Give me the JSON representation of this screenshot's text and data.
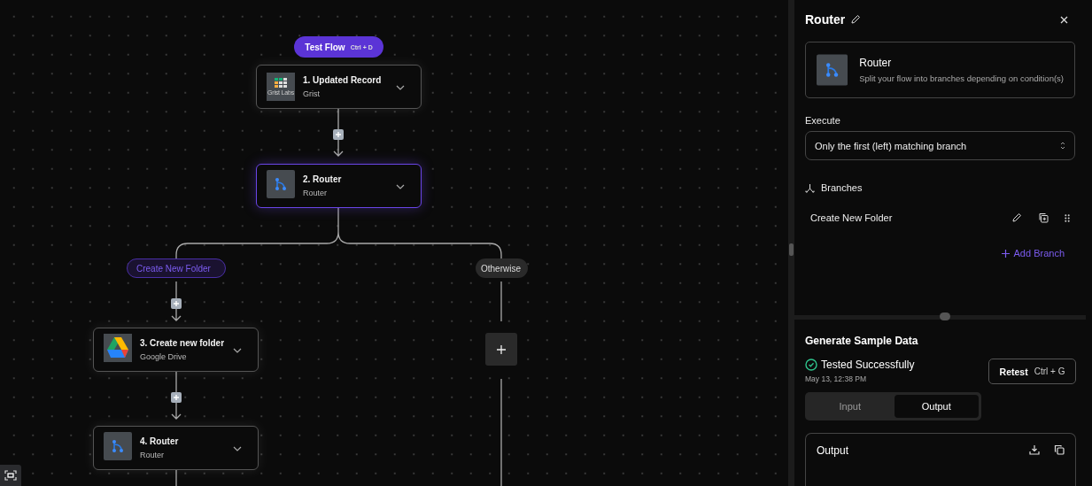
{
  "canvas": {
    "test_flow_button": {
      "label": "Test Flow",
      "shortcut": "Ctrl + D"
    },
    "steps": [
      {
        "title": "1. Updated Record",
        "app": "Grist",
        "kind": "grist",
        "logo_text": "Grist Labs",
        "selected": false
      },
      {
        "title": "2. Router",
        "app": "Router",
        "kind": "router",
        "selected": true
      },
      {
        "title": "3. Create new folder",
        "app": "Google Drive",
        "kind": "drive",
        "selected": false
      },
      {
        "title": "4. Router",
        "app": "Router",
        "kind": "router",
        "selected": false
      }
    ],
    "branches": [
      {
        "label": "Create New Folder",
        "kind": "condition"
      },
      {
        "label": "Otherwise",
        "kind": "fallback"
      }
    ]
  },
  "panel": {
    "title": "Router",
    "piece": {
      "name": "Router",
      "description": "Split your flow into branches depending on condition(s)"
    },
    "execute": {
      "label": "Execute",
      "value": "Only the first (left) matching branch"
    },
    "branches": {
      "heading": "Branches",
      "items": [
        {
          "label": "Create New Folder"
        }
      ],
      "add_label": "Add Branch"
    },
    "sample": {
      "heading": "Generate Sample Data",
      "status": "Tested Successfully",
      "time": "May 13, 12:38 PM",
      "retest": {
        "label": "Retest",
        "shortcut": "Ctrl + G"
      },
      "tabs": [
        {
          "label": "Input",
          "selected": false
        },
        {
          "label": "Output",
          "selected": true
        }
      ],
      "output_title": "Output"
    }
  }
}
